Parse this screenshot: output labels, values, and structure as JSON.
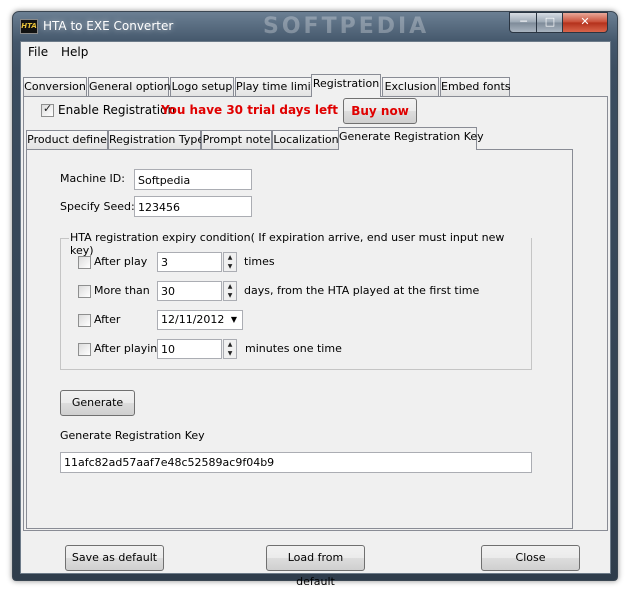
{
  "window": {
    "title": "HTA to EXE Converter",
    "watermark": "SOFTPEDIA",
    "icon_text": "HTA"
  },
  "caption": {
    "minimize": "─",
    "maximize": "□",
    "close": "✕"
  },
  "menu": [
    "File",
    "Help"
  ],
  "main_tabs": [
    "Conversion",
    "General option",
    "Logo setup",
    "Play time limit",
    "Registration",
    "Exclusion",
    "Embed fonts"
  ],
  "active_main_tab": "Registration",
  "registration": {
    "enable_label": "Enable Registration",
    "enabled": true,
    "trial_text": "You have 30 trial days left",
    "trial_color": "#e00000",
    "buy_now": "Buy now"
  },
  "sub_tabs": [
    "Product define",
    "Registration Type",
    "Prompt note",
    "Localization",
    "Generate Registration Key"
  ],
  "active_sub_tab": "Generate Registration Key",
  "form": {
    "machine_id_label": "Machine ID:",
    "machine_id": "Softpedia",
    "seed_label": "Specify Seed:",
    "seed": "123456",
    "expiry_group": "HTA registration expiry condition( If expiration arrive, end user must input new key)",
    "conditions": [
      {
        "label": "After play",
        "value": "3",
        "suffix": "times",
        "checked": false
      },
      {
        "label": "More than",
        "value": "30",
        "suffix": "days, from the HTA played at the first time",
        "checked": false
      },
      {
        "label": "After",
        "value": "12/11/2012",
        "suffix": "",
        "checked": false
      },
      {
        "label": "After playing",
        "value": "10",
        "suffix": "minutes one time",
        "checked": false
      }
    ],
    "generate_button": "Generate",
    "key_label": "Generate Registration Key",
    "key_value": "11afc82ad57aaf7e48c52589ac9f04b9"
  },
  "footer": {
    "save_default": "Save as default",
    "load_default": "Load from default",
    "close": "Close"
  },
  "icons": {
    "spin_up": "▲",
    "spin_down": "▼",
    "dropdown": "▼"
  }
}
